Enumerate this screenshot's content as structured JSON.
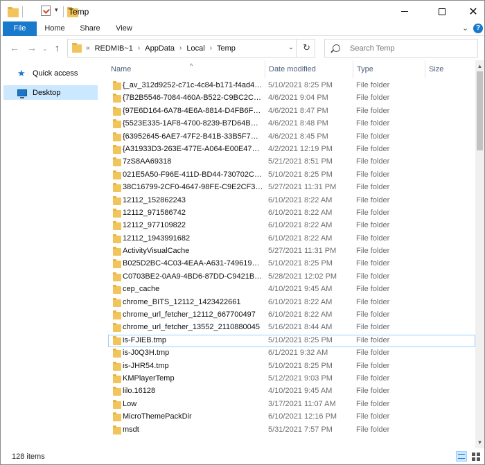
{
  "window": {
    "title": "Temp",
    "controls": {
      "minimize": "—",
      "maximize": "☐",
      "close": "✕"
    }
  },
  "ribbon": {
    "tabs": [
      {
        "id": "file",
        "label": "File"
      },
      {
        "id": "home",
        "label": "Home"
      },
      {
        "id": "share",
        "label": "Share"
      },
      {
        "id": "view",
        "label": "View"
      }
    ]
  },
  "address": {
    "breadcrumb_prefix": "«",
    "crumbs": [
      "REDMIB~1",
      "AppData",
      "Local",
      "Temp"
    ]
  },
  "search": {
    "placeholder": "Search Temp"
  },
  "nav_pane": {
    "items": [
      {
        "label": "Quick access",
        "icon": "star-icon"
      },
      {
        "label": "Desktop",
        "icon": "desktop-icon",
        "selected": true
      }
    ]
  },
  "columns": {
    "name": "Name",
    "date": "Date modified",
    "type": "Type",
    "size": "Size"
  },
  "files": [
    {
      "name": "{_av_312d9252-c71c-4c84-b171-f4ad46e2...",
      "date": "5/10/2021 8:25 PM",
      "type": "File folder"
    },
    {
      "name": "{7B2B5546-7084-460A-B522-C9BC2C1817...",
      "date": "4/6/2021 9:04 PM",
      "type": "File folder"
    },
    {
      "name": "{97E6D164-6A78-4E6A-8814-D4FB6F25CA...",
      "date": "4/6/2021 8:47 PM",
      "type": "File folder"
    },
    {
      "name": "{5523E335-1AF8-4700-8239-B7D64BBB6C...",
      "date": "4/6/2021 8:48 PM",
      "type": "File folder"
    },
    {
      "name": "{63952645-6AE7-47F2-B41B-33B5F7DFE9...",
      "date": "4/6/2021 8:45 PM",
      "type": "File folder"
    },
    {
      "name": "{A31933D3-263E-477E-A064-E00E472C80...",
      "date": "4/2/2021 12:19 PM",
      "type": "File folder"
    },
    {
      "name": "7zS8AA69318",
      "date": "5/21/2021 8:51 PM",
      "type": "File folder"
    },
    {
      "name": "021E5A50-F96E-411D-BD44-730702CA9612",
      "date": "5/10/2021 8:25 PM",
      "type": "File folder"
    },
    {
      "name": "38C16799-2CF0-4647-98FE-C9E2CF3A871E",
      "date": "5/27/2021 11:31 PM",
      "type": "File folder"
    },
    {
      "name": "12112_152862243",
      "date": "6/10/2021 8:22 AM",
      "type": "File folder"
    },
    {
      "name": "12112_971586742",
      "date": "6/10/2021 8:22 AM",
      "type": "File folder"
    },
    {
      "name": "12112_977109822",
      "date": "6/10/2021 8:22 AM",
      "type": "File folder"
    },
    {
      "name": "12112_1943991682",
      "date": "6/10/2021 8:22 AM",
      "type": "File folder"
    },
    {
      "name": "ActivityVisualCache",
      "date": "5/27/2021 11:31 PM",
      "type": "File folder"
    },
    {
      "name": "B025D2BC-4C03-4EAA-A631-7496191B3B...",
      "date": "5/10/2021 8:25 PM",
      "type": "File folder"
    },
    {
      "name": "C0703BE2-0AA9-4BD6-87DD-C9421B7A2...",
      "date": "5/28/2021 12:02 PM",
      "type": "File folder"
    },
    {
      "name": "cep_cache",
      "date": "4/10/2021 9:45 AM",
      "type": "File folder"
    },
    {
      "name": "chrome_BITS_12112_1423422661",
      "date": "6/10/2021 8:22 AM",
      "type": "File folder"
    },
    {
      "name": "chrome_url_fetcher_12112_667700497",
      "date": "6/10/2021 8:22 AM",
      "type": "File folder"
    },
    {
      "name": "chrome_url_fetcher_13552_2110880045",
      "date": "5/16/2021 8:44 AM",
      "type": "File folder"
    },
    {
      "name": "is-FJIEB.tmp",
      "date": "5/10/2021 8:25 PM",
      "type": "File folder",
      "focused": true
    },
    {
      "name": "is-J0Q3H.tmp",
      "date": "6/1/2021 9:32 AM",
      "type": "File folder"
    },
    {
      "name": "is-JHR54.tmp",
      "date": "5/10/2021 8:25 PM",
      "type": "File folder"
    },
    {
      "name": "KMPlayerTemp",
      "date": "5/12/2021 9:03 PM",
      "type": "File folder"
    },
    {
      "name": "lilo.16128",
      "date": "4/10/2021 9:45 AM",
      "type": "File folder"
    },
    {
      "name": "Low",
      "date": "3/17/2021 11:07 AM",
      "type": "File folder"
    },
    {
      "name": "MicroThemePackDir",
      "date": "6/10/2021 12:16 PM",
      "type": "File folder"
    },
    {
      "name": "msdt",
      "date": "5/31/2021 7:57 PM",
      "type": "File folder"
    }
  ],
  "status": {
    "item_count": "128 items"
  },
  "colors": {
    "accent": "#1979ca",
    "selection": "#cce8ff",
    "folder": "#f2c55c"
  }
}
